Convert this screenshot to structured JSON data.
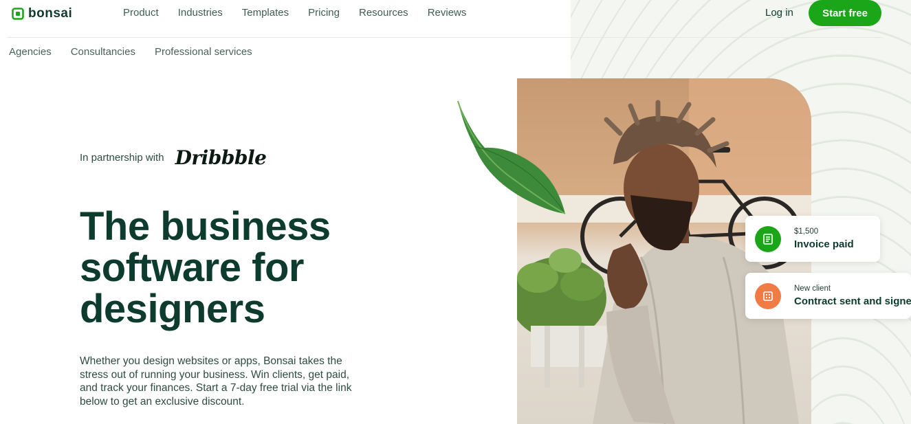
{
  "brand": {
    "name": "bonsai",
    "accent": "#1aa618",
    "dark": "#0d3b2e",
    "icon": "bonsai-logo-icon"
  },
  "nav": {
    "items": [
      "Product",
      "Industries",
      "Templates",
      "Pricing",
      "Resources",
      "Reviews"
    ],
    "login_label": "Log in",
    "start_label": "Start free"
  },
  "subnav": {
    "items": [
      "Agencies",
      "Consultancies",
      "Professional services"
    ]
  },
  "hero": {
    "partner_label": "In partnership with",
    "partner_logo": "Dribbble",
    "headline": [
      "The business",
      "software for",
      "designers"
    ],
    "description": "Whether you design websites or apps, Bonsai takes the stress out of running your business. Win clients, get paid, and track your finances. Start a 7-day free trial via the link below to get an exclusive discount."
  },
  "cards": [
    {
      "small": "$1,500",
      "big": "Invoice paid",
      "icon": "invoice-icon",
      "color": "#1aa618"
    },
    {
      "small": "New client",
      "big": "Contract sent and signed",
      "icon": "contract-icon",
      "color": "#ef7b45"
    }
  ]
}
